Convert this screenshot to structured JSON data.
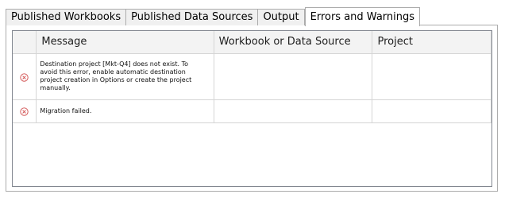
{
  "tabs": [
    {
      "label": "Published Workbooks"
    },
    {
      "label": "Published Data Sources"
    },
    {
      "label": "Output"
    },
    {
      "label": "Errors and Warnings",
      "active": true
    }
  ],
  "grid": {
    "columns": [
      "Message",
      "Workbook or Data Source",
      "Project"
    ],
    "rows": [
      {
        "icon": "error-icon",
        "message": "Destination project [Mkt-Q4] does not exist. To avoid this error, enable automatic destination project creation in Options or create the project manually.",
        "source": "",
        "project": ""
      },
      {
        "icon": "error-icon",
        "message": "Migration failed.",
        "source": "",
        "project": ""
      }
    ]
  },
  "colors": {
    "error_icon": "#d04a4a",
    "header_bg": "#f3f3f3",
    "grid_line": "#d5d5d5"
  }
}
